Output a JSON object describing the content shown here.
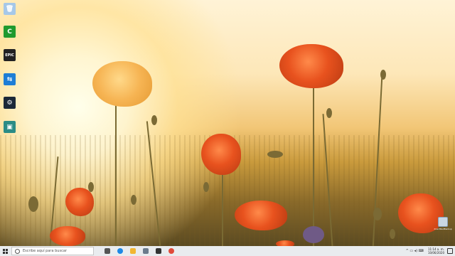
{
  "desktop": {
    "icons": [
      {
        "name": "recycle-bin-icon",
        "glyph": "🗑",
        "color": "#a6c8e8"
      },
      {
        "name": "camtasia-icon",
        "glyph": "C",
        "color": "#1f9a2e"
      },
      {
        "name": "epic-games-icon",
        "glyph": "EPIC",
        "color": "#222222"
      },
      {
        "name": "app-icon",
        "glyph": "⇆",
        "color": "#1e7ed6"
      },
      {
        "name": "steam-icon",
        "glyph": "⚙",
        "color": "#1b2838"
      },
      {
        "name": "game-launcher-icon",
        "glyph": "▣",
        "color": "#2b8c86"
      }
    ],
    "corner_icon_label": "directRedBackup"
  },
  "taskbar": {
    "search_placeholder": "Escribe aquí para buscar",
    "apps": [
      {
        "name": "task-view-icon",
        "color": "#555555"
      },
      {
        "name": "edge-icon",
        "color": "#1e88e5"
      },
      {
        "name": "file-explorer-icon",
        "color": "#f2b632"
      },
      {
        "name": "mail-icon",
        "color": "#6b7b8c"
      },
      {
        "name": "store-icon",
        "color": "#333333"
      },
      {
        "name": "recording-app-icon",
        "color": "#e04a3a"
      }
    ],
    "tray_icons": "^ ▭ ◂) ⌨",
    "time": "11:14 a. m.",
    "date": "10/06/2020"
  }
}
